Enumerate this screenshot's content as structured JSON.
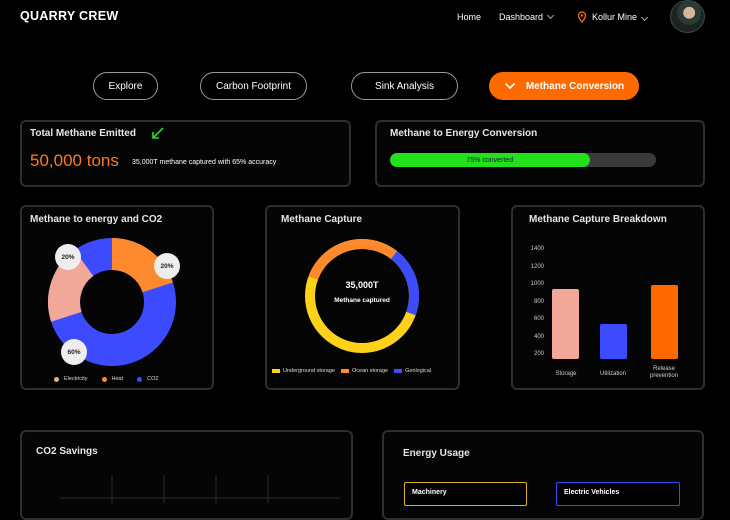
{
  "app": {
    "title": "QUARRY CREW"
  },
  "nav": {
    "home": "Home",
    "dashboard": "Dashboard",
    "location": "Kollur Mine"
  },
  "tabs": [
    "Explore",
    "Carbon Footprint",
    "Sink Analysis",
    "Methane Conversion"
  ],
  "active_tab": "Methane Conversion",
  "total": {
    "title": "Total Methane Emitted",
    "value": "50,000 tons",
    "note": "35,000T methane captured with 65% accuracy"
  },
  "conversion": {
    "title": "Methane to Energy Conversion",
    "label": "75% converted",
    "progress": 0.75
  },
  "energy_co2": {
    "title": "Methane to energy and CO2",
    "labels": [
      "20%",
      "20%",
      "60%"
    ],
    "legend": [
      "Electricity",
      "Heat",
      "CO2"
    ]
  },
  "capture": {
    "title": "Methane Capture",
    "center_value": "35,000T",
    "center_label": "Methane captured",
    "legend": [
      "Underground storage",
      "Ocean storage",
      "Geological"
    ]
  },
  "breakdown": {
    "title": "Methane Capture Breakdown",
    "yticks": [
      "1400",
      "1200",
      "1000",
      "800",
      "600",
      "400",
      "200"
    ],
    "cats": [
      "Storage",
      "Utilization",
      "Release prevention"
    ]
  },
  "savings": {
    "title": "CO2 Savings"
  },
  "usage": {
    "title": "Energy Usage",
    "items": [
      "Machinery",
      "Electric Vehicles"
    ]
  },
  "colors": {
    "accent": "#ff6a00",
    "green": "#22e01a",
    "blue": "#3d4bff",
    "salmon": "#f1a898",
    "orange": "#ff8a2e",
    "yellow": "#ffd21a"
  },
  "chart_data": [
    {
      "type": "pie",
      "title": "Methane to energy and CO2",
      "series": [
        {
          "name": "Electricity",
          "value": 20
        },
        {
          "name": "Heat",
          "value": 20
        },
        {
          "name": "CO2",
          "value": 60
        }
      ]
    },
    {
      "type": "pie",
      "title": "Methane Capture",
      "series": [
        {
          "name": "Underground storage",
          "value": 50
        },
        {
          "name": "Ocean storage",
          "value": 30
        },
        {
          "name": "Geological",
          "value": 20
        }
      ]
    },
    {
      "type": "bar",
      "title": "Methane Capture Breakdown",
      "categories": [
        "Storage",
        "Utilization",
        "Release prevention"
      ],
      "values": [
        950,
        550,
        1000
      ],
      "ylim": [
        200,
        1400
      ]
    }
  ]
}
